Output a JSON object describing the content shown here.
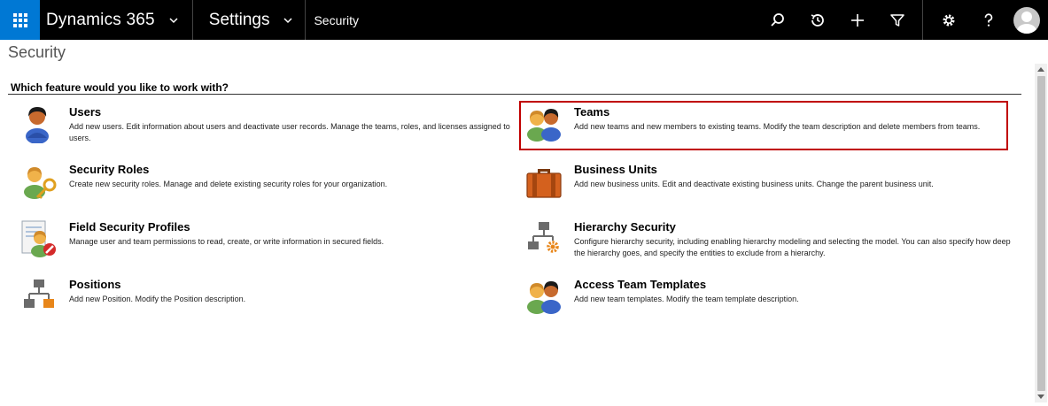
{
  "header": {
    "app_name": "Dynamics 365",
    "area_name": "Settings",
    "breadcrumb": "Security"
  },
  "page": {
    "title": "Security",
    "question": "Which feature would you like to work with?"
  },
  "features": [
    {
      "title": "Users",
      "description": "Add new users. Edit information about users and deactivate user records. Manage the teams, roles, and licenses assigned to users.",
      "icon": "user-icon"
    },
    {
      "title": "Teams",
      "description": "Add new teams and new members to existing teams. Modify the team description and delete members from teams.",
      "icon": "team-icon"
    },
    {
      "title": "Security Roles",
      "description": "Create new security roles. Manage and delete existing security roles for your organization.",
      "icon": "security-role-key-icon"
    },
    {
      "title": "Business Units",
      "description": "Add new business units. Edit and deactivate existing business units. Change the parent business unit.",
      "icon": "briefcase-icon"
    },
    {
      "title": "Field Security Profiles",
      "description": "Manage user and team permissions to read, create, or write information in secured fields.",
      "icon": "field-security-profile-icon"
    },
    {
      "title": "Hierarchy Security",
      "description": "Configure hierarchy security, including enabling hierarchy modeling and selecting the model. You can also specify how deep the hierarchy goes, and specify the entities to exclude from a hierarchy.",
      "icon": "hierarchy-gear-icon"
    },
    {
      "title": "Positions",
      "description": "Add new Position. Modify the Position description.",
      "icon": "hierarchy-icon"
    },
    {
      "title": "Access Team Templates",
      "description": "Add new team templates. Modify the team template description.",
      "icon": "team-template-icon"
    }
  ],
  "colors": {
    "topbar": "#000000",
    "waffle": "#0078d4",
    "highlight_border": "#c00000"
  }
}
